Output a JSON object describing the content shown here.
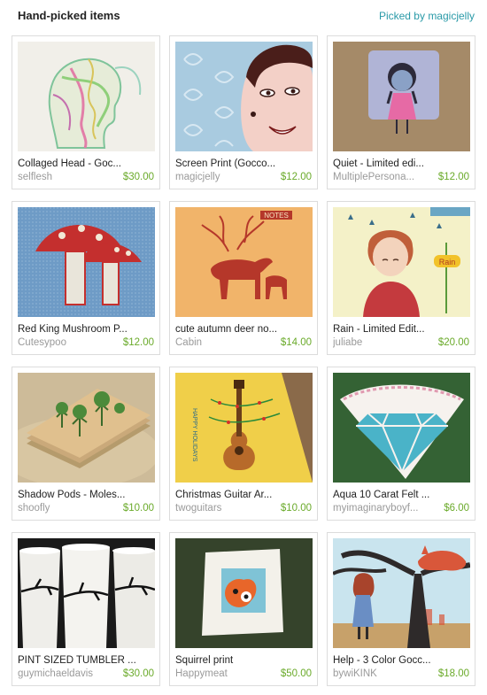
{
  "header": {
    "title": "Hand-picked items",
    "picked_by": "Picked by magicjelly"
  },
  "items": [
    {
      "title": "Collaged Head - Goc...",
      "shop": "selflesh",
      "price": "$30.00"
    },
    {
      "title": "Screen Print (Gocco...",
      "shop": "magicjelly",
      "price": "$12.00"
    },
    {
      "title": "Quiet - Limited edi...",
      "shop": "MultiplePersona...",
      "price": "$12.00"
    },
    {
      "title": "Red King Mushroom P...",
      "shop": "Cutesypoo",
      "price": "$12.00"
    },
    {
      "title": "cute autumn deer no...",
      "shop": "Cabin",
      "price": "$14.00"
    },
    {
      "title": "Rain - Limited Edit...",
      "shop": "juliabe",
      "price": "$20.00"
    },
    {
      "title": "Shadow Pods - Moles...",
      "shop": "shoofly",
      "price": "$10.00"
    },
    {
      "title": "Christmas Guitar Ar...",
      "shop": "twoguitars",
      "price": "$10.00"
    },
    {
      "title": "Aqua 10 Carat Felt ...",
      "shop": "myimaginaryboyf...",
      "price": "$6.00"
    },
    {
      "title": "PINT SIZED TUMBLER ...",
      "shop": "guymichaeldavis",
      "price": "$30.00"
    },
    {
      "title": "Squirrel print",
      "shop": "Happymeat",
      "price": "$50.00"
    },
    {
      "title": "Help - 3 Color Gocc...",
      "shop": "bywiKINK",
      "price": "$18.00"
    }
  ],
  "thumb_text": {
    "notes": "NOTES",
    "rain": "Rain",
    "holidays": "HAPPY HOLIDAYS"
  },
  "colors": {
    "link": "#2a9aa8",
    "price": "#6aaa2a",
    "shop": "#9a9a9a",
    "border": "#dcdcdc"
  }
}
